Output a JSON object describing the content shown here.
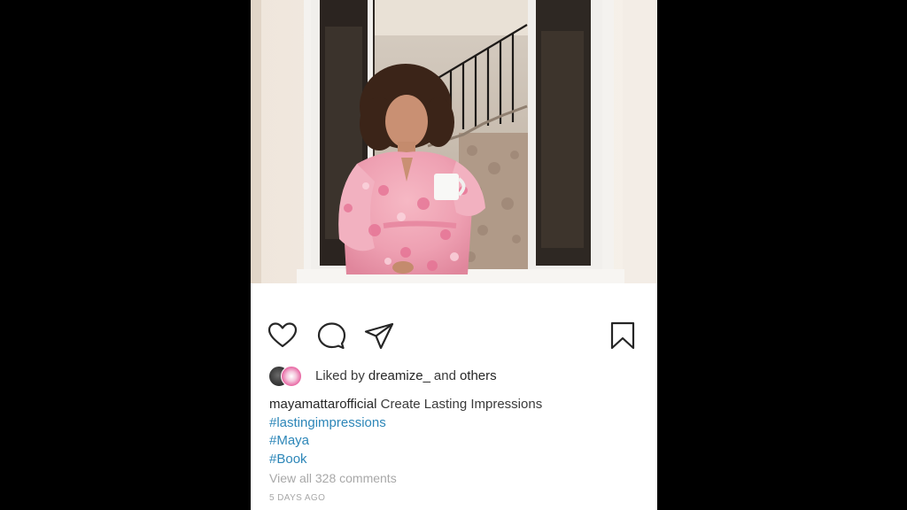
{
  "post": {
    "photo_alt": "",
    "likes": {
      "prefix": "Liked by",
      "user": "dreamize_",
      "joiner": "and",
      "others": "others"
    },
    "caption": {
      "username": "mayamattarofficial",
      "text": "Create Lasting Impressions",
      "hashtags": [
        "#lastingimpressions",
        "#Maya",
        "#Book"
      ]
    },
    "view_comments": "View all 328 comments",
    "timestamp": "5 DAYS AGO"
  },
  "icons": {
    "like": "heart-icon",
    "comment": "comment-bubble-icon",
    "share": "paper-plane-icon",
    "save": "bookmark-icon"
  },
  "colors": {
    "background": "#000000",
    "card": "#ffffff",
    "text": "#262626",
    "hashtag": "#2c86b8",
    "muted": "#a8a8a8"
  }
}
